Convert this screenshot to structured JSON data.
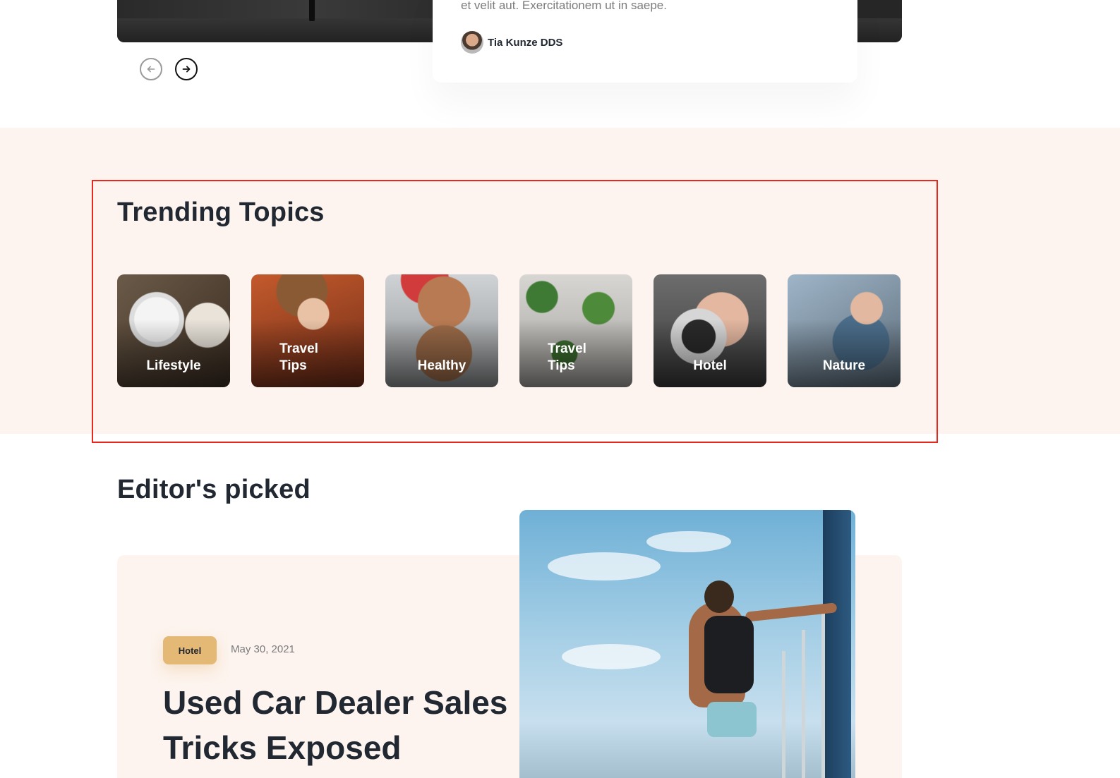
{
  "hero": {
    "excerpt": "et velit aut. Exercitationem ut in saepe.",
    "author_name": "Tia Kunze DDS"
  },
  "slider_nav": {
    "prev_icon": "arrow-left-circle-icon",
    "next_icon": "arrow-right-circle-icon"
  },
  "trending": {
    "title": "Trending Topics",
    "topics": [
      {
        "label": "Lifestyle"
      },
      {
        "label": "Travel Tips"
      },
      {
        "label": "Healthy"
      },
      {
        "label": "Travel Tips"
      },
      {
        "label": "Hotel"
      },
      {
        "label": "Nature"
      }
    ]
  },
  "editors_picked": {
    "title": "Editor's picked",
    "post": {
      "tag": "Hotel",
      "date": "May 30, 2021",
      "title": "Used Car Dealer Sales Tricks Exposed"
    }
  },
  "colors": {
    "section_bg": "#fdf4ef",
    "tag_bg": "#e4b875",
    "highlight_border": "#e8271e",
    "heading": "#212832"
  }
}
